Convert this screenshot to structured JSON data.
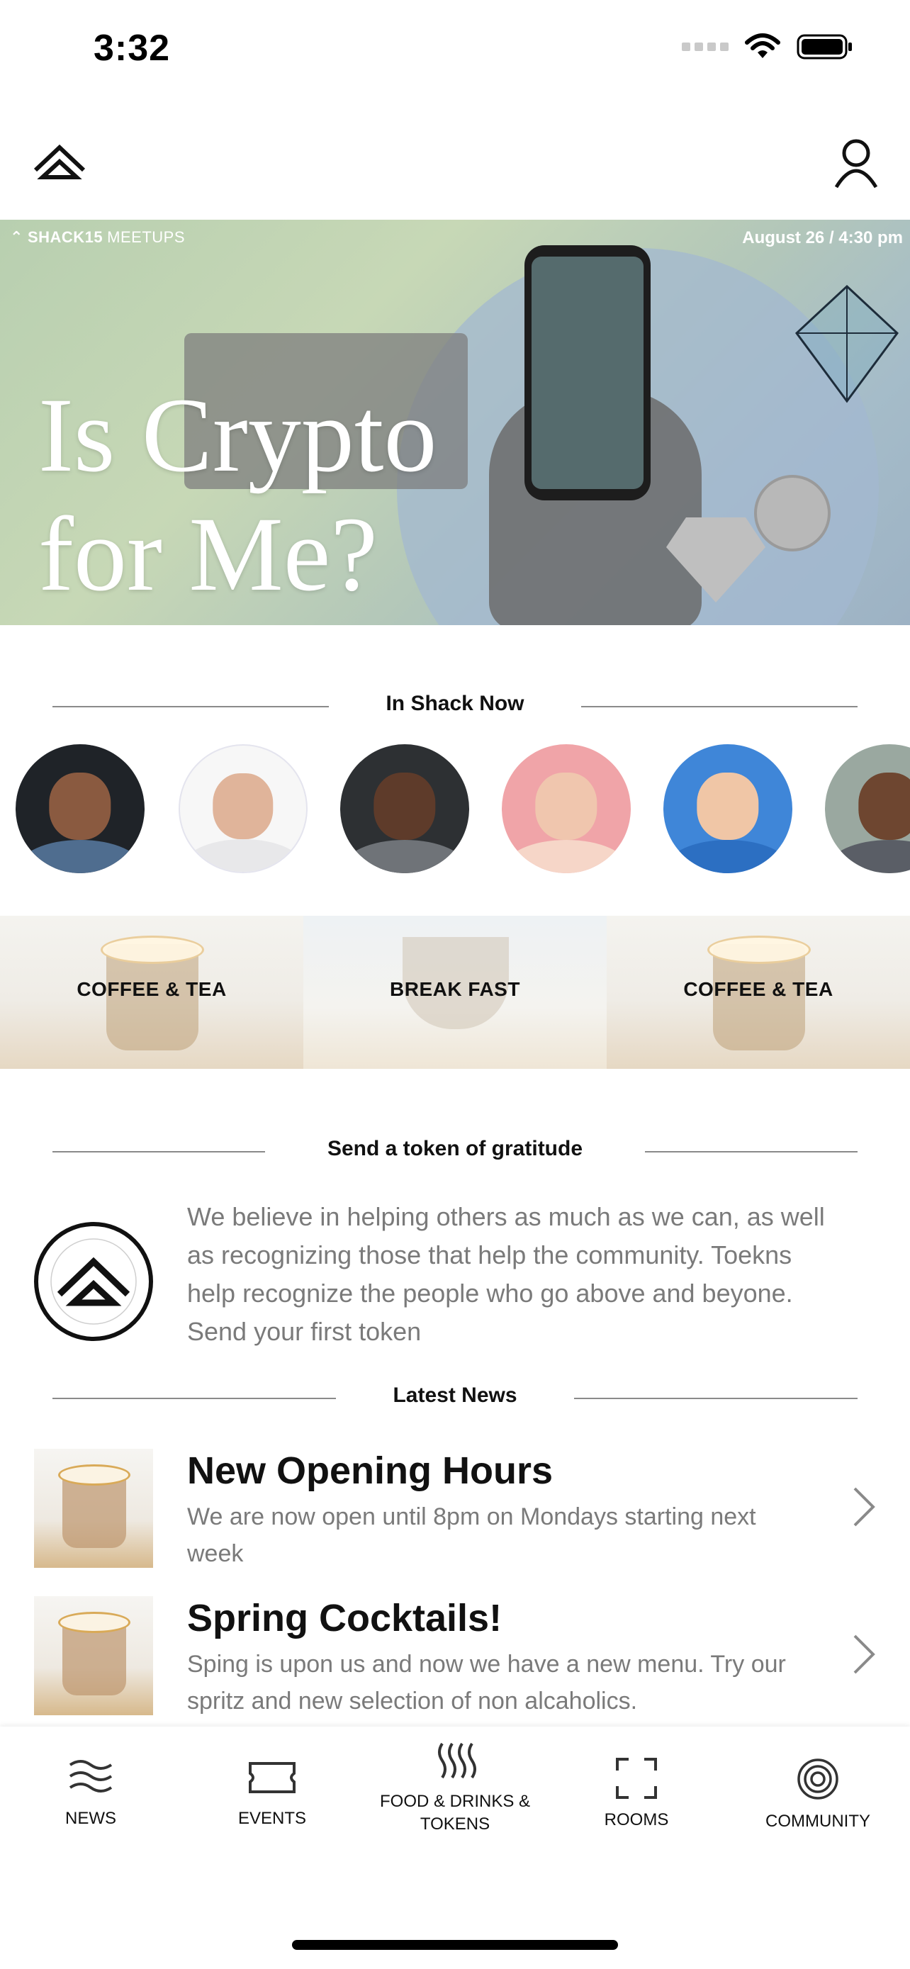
{
  "status_bar": {
    "time": "3:32"
  },
  "hero": {
    "brand_bold": "SHACK15",
    "brand_light": "MEETUPS",
    "date": "August 26 / 4:30 pm",
    "title": "Is Crypto\nfor Me?"
  },
  "in_shack": {
    "heading": "In Shack Now",
    "avatars": [
      {
        "name": "avatar-1"
      },
      {
        "name": "avatar-2"
      },
      {
        "name": "avatar-3"
      },
      {
        "name": "avatar-4"
      },
      {
        "name": "avatar-5"
      },
      {
        "name": "avatar-6"
      }
    ]
  },
  "categories": [
    {
      "label": "COFFEE & TEA"
    },
    {
      "label": "BREAK FAST"
    },
    {
      "label": "COFFEE & TEA"
    }
  ],
  "gratitude": {
    "heading": "Send a token of gratitude",
    "text": "We believe in helping others as much as we can, as well as recognizing those that help the community. Toekns help recognize the people who go above and beyone. Send your first token"
  },
  "news": {
    "heading": "Latest News",
    "items": [
      {
        "title": "New Opening Hours",
        "body": "We are now open until 8pm on Mondays starting next week"
      },
      {
        "title": "Spring Cocktails!",
        "body": "Sping is upon us and now we have a new menu. Try our spritz and new selection of non alcaholics."
      }
    ]
  },
  "tabs": {
    "news": "NEWS",
    "events": "EVENTS",
    "food": "FOOD & DRINKS &\nTOKENS",
    "rooms": "ROOMS",
    "community": "COMMUNITY"
  }
}
